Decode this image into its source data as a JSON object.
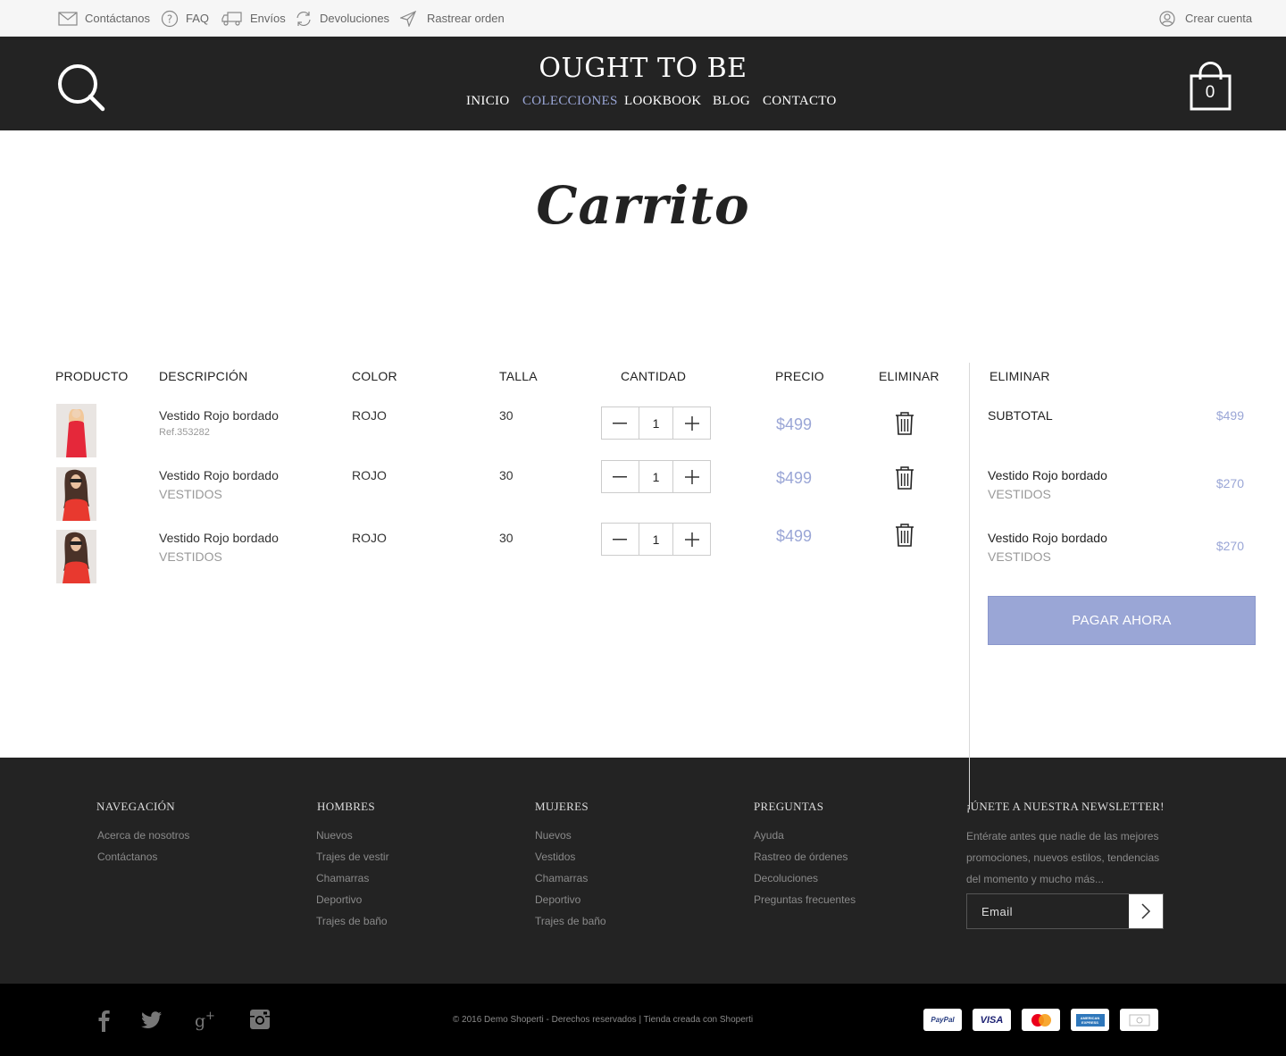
{
  "topbar": {
    "links": [
      {
        "label": "Contáctanos",
        "icon": "envelope-icon"
      },
      {
        "label": "FAQ",
        "icon": "question-icon"
      },
      {
        "label": "Envíos",
        "icon": "truck-icon"
      },
      {
        "label": "Devoluciones",
        "icon": "refresh-icon"
      },
      {
        "label": "Rastrear orden",
        "icon": "send-icon"
      }
    ],
    "account": {
      "label": "Crear cuenta",
      "icon": "user-icon"
    }
  },
  "header": {
    "logo": "OUGHT TO BE",
    "nav": [
      {
        "label": "INICIO",
        "active": false
      },
      {
        "label": "COLECCIONES",
        "active": true
      },
      {
        "label": "LOOKBOOK",
        "active": false
      },
      {
        "label": "BLOG",
        "active": false
      },
      {
        "label": "CONTACTO",
        "active": false
      }
    ],
    "cart_count": "0"
  },
  "page_title": "Carrito",
  "cart_table": {
    "headers": {
      "product": "PRODUCTO",
      "description": "DESCRIPCIÓN",
      "color": "COLOR",
      "size": "TALLA",
      "quantity": "CANTIDAD",
      "price": "PRECIO",
      "remove": "ELIMINAR"
    },
    "rows": [
      {
        "name": "Vestido Rojo bordado",
        "sub": "Ref.353282",
        "color": "ROJO",
        "size": "30",
        "qty": "1",
        "price": "$499"
      },
      {
        "name": "Vestido Rojo bordado",
        "sub": "VESTIDOS",
        "color": "ROJO",
        "size": "30",
        "qty": "1",
        "price": "$499"
      },
      {
        "name": "Vestido Rojo bordado",
        "sub": "VESTIDOS",
        "color": "ROJO",
        "size": "30",
        "qty": "1",
        "price": "$499"
      }
    ]
  },
  "summary": {
    "header": "ELIMINAR",
    "subtotal_label": "SUBTOTAL",
    "subtotal_value": "$499",
    "items": [
      {
        "name": "Vestido Rojo bordado",
        "category": "VESTIDOS",
        "price": "$270"
      },
      {
        "name": "Vestido Rojo bordado",
        "category": "VESTIDOS",
        "price": "$270"
      }
    ],
    "pay_button": "PAGAR AHORA"
  },
  "footer": {
    "columns": [
      {
        "title": "NAVEGACIÓN",
        "links": [
          "Acerca de nosotros",
          "Contáctanos"
        ]
      },
      {
        "title": "HOMBRES",
        "links": [
          "Nuevos",
          "Trajes de vestir",
          "Chamarras",
          "Deportivo",
          "Trajes de baño"
        ]
      },
      {
        "title": "MUJERES",
        "links": [
          "Nuevos",
          "Vestidos",
          "Chamarras",
          "Deportivo",
          "Trajes de baño"
        ]
      },
      {
        "title": "PREGUNTAS",
        "links": [
          "Ayuda",
          "Rastreo de órdenes",
          "Decoluciones",
          "Preguntas frecuentes"
        ]
      }
    ],
    "newsletter": {
      "title": "¡ÚNETE A NUESTRA NEWSLETTER!",
      "description": "Entérate antes que nadie de las mejores promociones, nuevos estilos, tendencias del momento y mucho más...",
      "email_placeholder": "Email"
    }
  },
  "bottombar": {
    "social": [
      "facebook-icon",
      "twitter-icon",
      "google-plus-icon",
      "instagram-icon"
    ],
    "copyright": "© 2016 Demo Shoperti - Derechos reservados | Tienda creada con Shoperti",
    "payments": [
      "PayPal",
      "VISA",
      "mastercard",
      "AMERICAN EXPRESS",
      "cash"
    ]
  },
  "colors": {
    "accent": "#9aa6d6",
    "header_bg": "#232323",
    "footer_bg": "#232323",
    "bottom_bg": "#000000"
  }
}
